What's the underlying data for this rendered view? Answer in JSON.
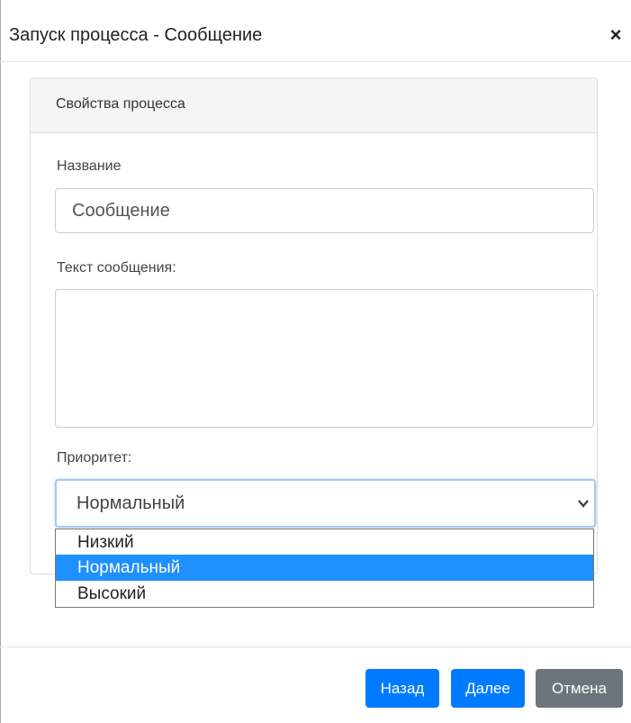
{
  "dialog": {
    "title": "Запуск процесса - Сообщение",
    "close_icon": "×"
  },
  "panel": {
    "title": "Свойства процесса"
  },
  "form": {
    "name_label": "Название",
    "name_value": "Сообщение",
    "message_label": "Текст сообщения:",
    "message_value": "",
    "priority_label": "Приоритет:",
    "priority_selected": "Нормальный",
    "priority_options": [
      "Низкий",
      "Нормальный",
      "Высокий"
    ]
  },
  "footer": {
    "back_label": "Назад",
    "next_label": "Далее",
    "cancel_label": "Отмена"
  },
  "colors": {
    "primary": "#007bff",
    "secondary": "#6c757d",
    "highlight": "#1e90ff"
  }
}
